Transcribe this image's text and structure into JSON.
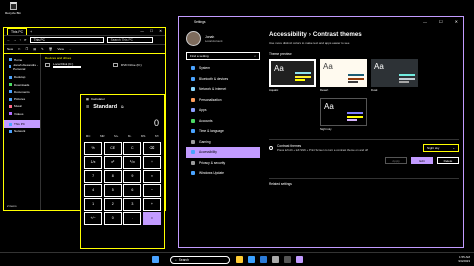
{
  "desktop": {
    "recycle_bin": "Recycle Bin"
  },
  "explorer": {
    "tab": "This PC",
    "address": "This PC",
    "search_placeholder": "Search This PC",
    "toolbar": [
      "New",
      "View",
      "..."
    ],
    "sidebar": [
      "Home",
      "Jonah Alexandre - Personal",
      "Desktop",
      "Downloads",
      "Documents",
      "Pictures",
      "Music",
      "Videos",
      "This PC",
      "Network"
    ],
    "selected_sidebar": "This PC",
    "devices_header": "Devices and drives",
    "drives": [
      {
        "name": "Local Disk (C:)",
        "free": ""
      },
      {
        "name": "DVD Drive (D:)",
        "free": ""
      }
    ],
    "status": "2 items"
  },
  "calculator": {
    "title": "Calculator",
    "mode": "Standard",
    "display": "0",
    "memory": [
      "MC",
      "MR",
      "M+",
      "M-",
      "MS",
      "M˅"
    ],
    "keys": [
      "%",
      "CE",
      "C",
      "⌫",
      "1/x",
      "x²",
      "²√x",
      "÷",
      "7",
      "8",
      "9",
      "×",
      "4",
      "5",
      "6",
      "−",
      "1",
      "2",
      "3",
      "+",
      "+/−",
      "0",
      ".",
      "="
    ]
  },
  "settings": {
    "title": "Settings",
    "user_name": "Jonah",
    "account": "Local Account",
    "find_placeholder": "Find a setting",
    "nav": [
      {
        "label": "System",
        "color": "#4aa3ff"
      },
      {
        "label": "Bluetooth & devices",
        "color": "#4aa3ff"
      },
      {
        "label": "Network & internet",
        "color": "#8ad8ff"
      },
      {
        "label": "Personalization",
        "color": "#ff9d5c"
      },
      {
        "label": "Apps",
        "color": "#8b9eff"
      },
      {
        "label": "Accounts",
        "color": "#4cd964"
      },
      {
        "label": "Time & language",
        "color": "#4aa3ff"
      },
      {
        "label": "Gaming",
        "color": "#9b9b9b"
      },
      {
        "label": "Accessibility",
        "color": "#4aa3ff"
      },
      {
        "label": "Privacy & security",
        "color": "#9b9b9b"
      },
      {
        "label": "Windows Update",
        "color": "#4aa3ff"
      }
    ],
    "selected_nav": "Accessibility",
    "breadcrumb_parent": "Accessibility",
    "breadcrumb_sep": "›",
    "breadcrumb_current": "Contrast themes",
    "description": "Use more distinct colors to make text and apps easier to see",
    "theme_preview_label": "Theme preview",
    "themes": [
      "Aquatic",
      "Desert",
      "Dusk",
      "Night sky"
    ],
    "contrast_title": "Contrast themes",
    "contrast_sub": "Press left Alt + left Shift + Print Screen to turn a contrast theme on and off",
    "contrast_value": "Night sky",
    "apply_label": "Apply",
    "edit_label": "Edit",
    "delete_label": "Delete",
    "related_label": "Related settings"
  },
  "taskbar": {
    "search_label": "Search",
    "time": "1:55 AM",
    "date": "9/4/2023"
  }
}
